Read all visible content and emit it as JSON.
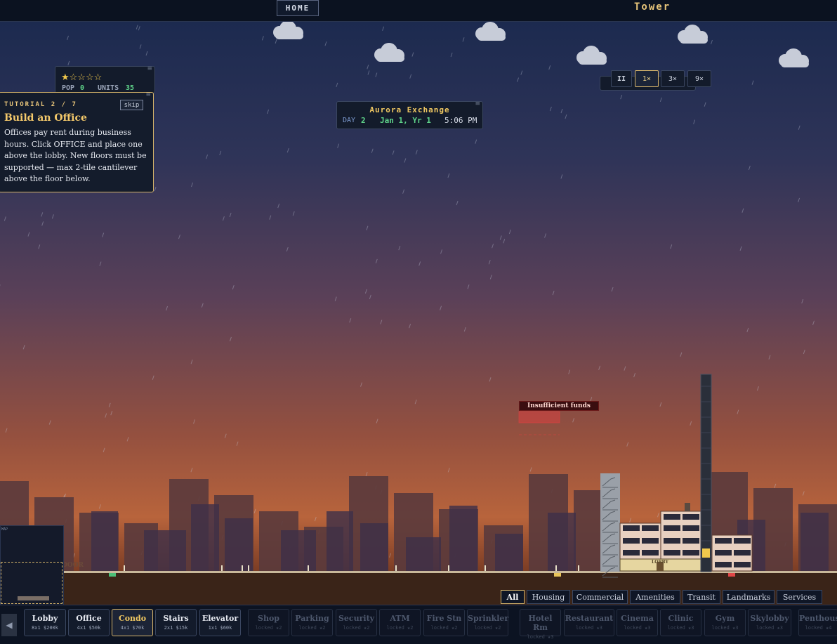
{
  "header": {
    "home_label": "HOME",
    "title": "Tower"
  },
  "rating": {
    "stars": "★☆☆☆☆",
    "pop_label": "POP",
    "pop_value": "0",
    "units_label": "UNITS",
    "units_value": "35"
  },
  "tutorial": {
    "step": "TUTORIAL 2 / 7",
    "skip_label": "skip",
    "title": "Build an Office",
    "body": "Offices pay rent during business hours. Click OFFICE and place one above the lobby. New floors must be supported — max 2-tile cantilever above the floor below."
  },
  "clock": {
    "name": "Aurora Exchange",
    "day_label": "DAY",
    "day_value": "2",
    "date": "Jan 1, Yr 1",
    "time": "5:06 PM"
  },
  "speed": {
    "pause": "II",
    "s1": "1×",
    "s3": "3×",
    "s9": "9×"
  },
  "notice": {
    "insufficient": "Insufficient funds"
  },
  "building": {
    "lobby_label": "LOBBY",
    "condo_label": "CONDO",
    "door_label": "DOOR",
    "map_label": "MAP"
  },
  "filters": [
    "All",
    "Housing",
    "Commercial",
    "Amenities",
    "Transit",
    "Landmarks",
    "Services"
  ],
  "tools": [
    {
      "name": "Lobby",
      "cost": "8x1 $200k"
    },
    {
      "name": "Office",
      "cost": "4x1 $50k"
    },
    {
      "name": "Condo",
      "cost": "4x1 $70k"
    },
    {
      "name": "Stairs",
      "cost": "2x1 $15k"
    },
    {
      "name": "Elevator",
      "cost": "1x1 $60k"
    },
    {
      "name": "Shop",
      "cost": "locked ★2"
    },
    {
      "name": "Parking",
      "cost": "locked ★2"
    },
    {
      "name": "Security",
      "cost": "locked ★2"
    },
    {
      "name": "ATM",
      "cost": "locked ★2"
    },
    {
      "name": "Fire Stn",
      "cost": "locked ★2"
    },
    {
      "name": "Sprinkler",
      "cost": "locked ★2"
    },
    {
      "name": "Hotel Rm",
      "cost": "locked ★3"
    },
    {
      "name": "Restaurant",
      "cost": "locked ★3"
    },
    {
      "name": "Cinema",
      "cost": "locked ★3"
    },
    {
      "name": "Clinic",
      "cost": "locked ★3"
    },
    {
      "name": "Gym",
      "cost": "locked ★3"
    },
    {
      "name": "Skylobby",
      "cost": "locked ★3"
    },
    {
      "name": "Penthouse",
      "cost": "locked ★4"
    }
  ],
  "colors": {
    "accent": "#f0c862",
    "panel": "#131b2b",
    "sky_top": "#1a2548",
    "sky_bottom": "#b8623a"
  }
}
